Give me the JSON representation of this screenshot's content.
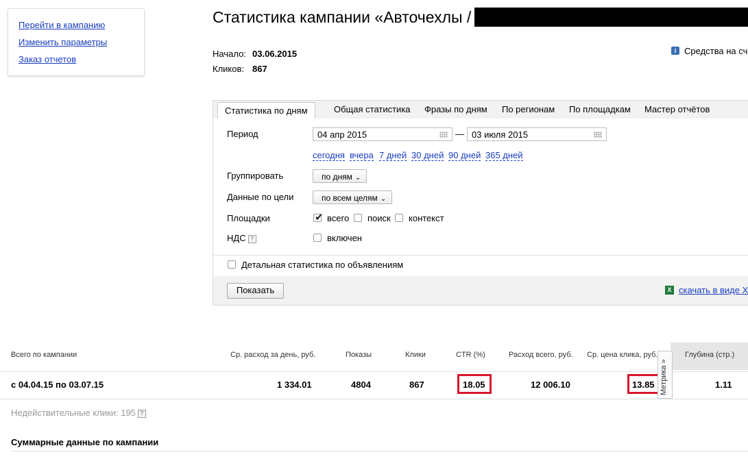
{
  "sidebar": {
    "links": [
      "Перейти в кампанию",
      "Изменить параметры",
      "Заказ отчетов"
    ]
  },
  "header": {
    "title": "Статистика кампании «Авточехлы /",
    "start_label": "Начало:",
    "start_value": "03.06.2015",
    "clicks_label": "Кликов:",
    "clicks_value": "867",
    "funds_text": "Средства на сч",
    "funds_icon": "info-icon"
  },
  "tabs": [
    "Статистика по дням",
    "Общая статистика",
    "Фразы по дням",
    "По регионам",
    "По площадкам",
    "Мастер отчётов"
  ],
  "form": {
    "period_label": "Период",
    "date_from": "04 апр 2015",
    "date_dash": "—",
    "date_to": "03 июля 2015",
    "quick_ranges": [
      "сегодня",
      "вчера",
      "7 дней",
      "30 дней",
      "90 дней",
      "365 дней"
    ],
    "group_label": "Группировать",
    "group_value": "по дням",
    "goal_label": "Данные по цели",
    "goal_value": "по всем целям",
    "platforms_label": "Площадки",
    "platform_all": "всего",
    "platform_search": "поиск",
    "platform_context": "контекст",
    "vat_label": "НДС",
    "vat_option": "включен",
    "detailed_label": "Детальная статистика по объявлениям",
    "show_button": "Показать",
    "download_label": "скачать в виде X"
  },
  "table": {
    "headers": {
      "total": "Всего по кампании",
      "avg_spend": "Ср. расход за день, руб.",
      "impressions": "Показы",
      "clicks": "Клики",
      "ctr": "CTR (%)",
      "spend_total": "Расход всего, руб.",
      "avg_cpc": "Ср. цена клика, руб.",
      "depth": "Глубина (стр.)"
    },
    "row": {
      "period": "с 04.04.15 по 03.07.15",
      "avg_spend": "1 334.01",
      "impressions": "4804",
      "clicks": "867",
      "ctr": "18.05",
      "spend_total": "12 006.10",
      "avg_cpc": "13.85",
      "depth": "1.11"
    },
    "metrika_label": "Метрика »",
    "highlight_color": "#d7162c"
  },
  "footer": {
    "invalid_clicks": "Недействительные клики: 195",
    "summary_title": "Суммарные данные по кампании"
  }
}
